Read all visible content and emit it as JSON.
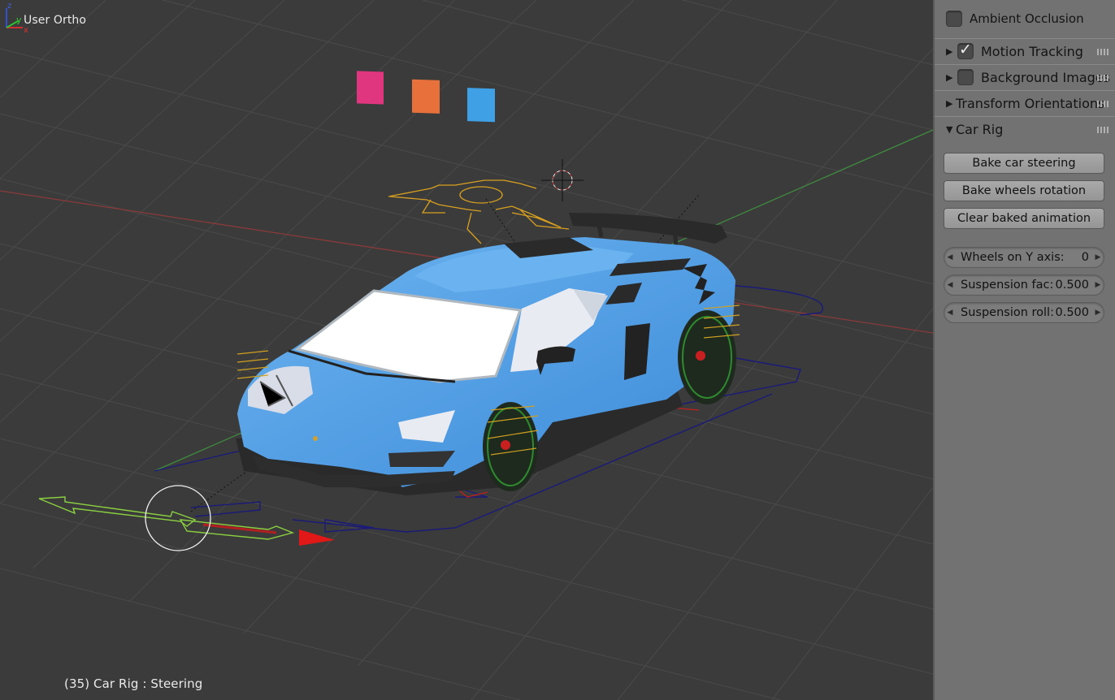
{
  "viewport": {
    "view_name": "User Ortho",
    "object_info": "(35) Car Rig : Steering",
    "swatch_colors": [
      "#e0357f",
      "#e8703a",
      "#3fa0e6"
    ],
    "car_color": "#5aa6e8",
    "axis_labels": {
      "x": "x",
      "y": "y",
      "z": "z"
    }
  },
  "sidepanel": {
    "ambient_occlusion": {
      "label": "Ambient Occlusion",
      "checked": false
    },
    "sections": [
      {
        "label": "Motion Tracking",
        "expanded": false,
        "has_checkbox": true,
        "checked": true
      },
      {
        "label": "Background Images",
        "expanded": false,
        "has_checkbox": true,
        "checked": false
      },
      {
        "label": "Transform Orientations",
        "expanded": false,
        "has_checkbox": false
      },
      {
        "label": "Car Rig",
        "expanded": true,
        "has_checkbox": false
      }
    ],
    "car_rig": {
      "buttons": [
        "Bake car steering",
        "Bake wheels rotation",
        "Clear baked animation"
      ],
      "fields": [
        {
          "label": "Wheels on Y axis:",
          "value": "0"
        },
        {
          "label": "Suspension fac:",
          "value": "0.500"
        },
        {
          "label": "Suspension roll:",
          "value": "0.500"
        }
      ]
    }
  }
}
